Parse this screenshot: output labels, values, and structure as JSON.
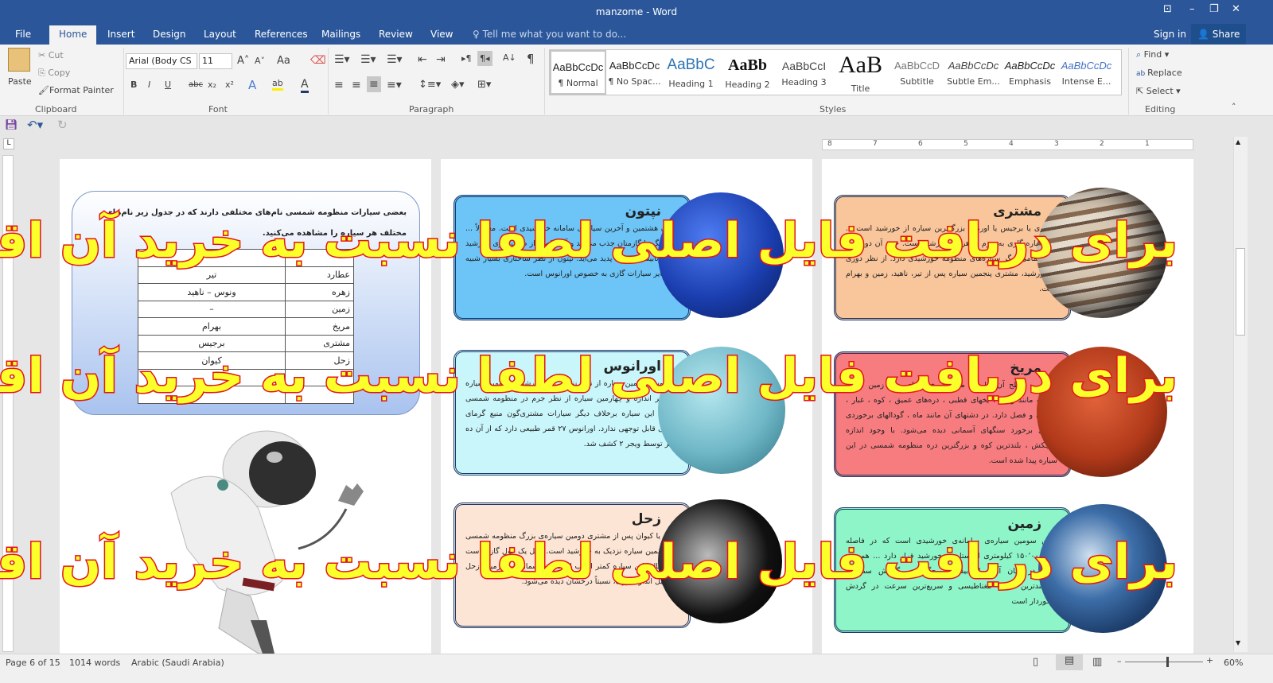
{
  "window": {
    "title": "manzome - Word",
    "controls": [
      "ribbon-display",
      "minimize",
      "restore",
      "close"
    ]
  },
  "tabs": [
    "File",
    "Home",
    "Insert",
    "Design",
    "Layout",
    "References",
    "Mailings",
    "Review",
    "View"
  ],
  "tell_me": "Tell me what you want to do...",
  "sign_in": "Sign in",
  "share": "Share",
  "clipboard": {
    "paste": "Paste",
    "cut": "Cut",
    "copy": "Copy",
    "format_painter": "Format Painter",
    "label": "Clipboard"
  },
  "font": {
    "name": "Arial (Body CS",
    "size": "11",
    "label": "Font",
    "bold": "B",
    "italic": "I",
    "underline": "U",
    "strike": "abc",
    "sub": "x₂",
    "sup": "x²",
    "case": "Aa"
  },
  "paragraph": {
    "label": "Paragraph"
  },
  "styles": {
    "label": "Styles",
    "items": [
      {
        "preview": "AaBbCcDc",
        "name": "¶ Normal"
      },
      {
        "preview": "AaBbCcDc",
        "name": "¶ No Spac..."
      },
      {
        "preview": "AaBbC",
        "name": "Heading 1"
      },
      {
        "preview": "AaBb",
        "name": "Heading 2"
      },
      {
        "preview": "AaBbCcI",
        "name": "Heading 3"
      },
      {
        "preview": "AaB",
        "name": "Title"
      },
      {
        "preview": "AaBbCcD",
        "name": "Subtitle"
      },
      {
        "preview": "AaBbCcDc",
        "name": "Subtle Em..."
      },
      {
        "preview": "AaBbCcDc",
        "name": "Emphasis"
      },
      {
        "preview": "AaBbCcDc",
        "name": "Intense E..."
      }
    ]
  },
  "editing": {
    "find": "Find",
    "replace": "Replace",
    "select": "Select",
    "label": "Editing"
  },
  "ruler": {
    "numbers": [
      "8",
      "7",
      "6",
      "5",
      "4",
      "3",
      "2",
      "1"
    ]
  },
  "page1": {
    "intro": "بعضی سیارات منظومه شمسی نام‌های مختلفی دارند که در جدول زیر نام‌های مختلف هر سیاره را مشاهده می‌کنید.",
    "table": [
      [
        "",
        ""
      ],
      [
        "عطارد",
        "تیر"
      ],
      [
        "زهره",
        "ونوس – ناهید"
      ],
      [
        "زمین",
        "–"
      ],
      [
        "مریخ",
        "بهرام"
      ],
      [
        "مشتری",
        "برجیس"
      ],
      [
        "زحل",
        "کیوان"
      ],
      [
        "",
        ""
      ],
      [
        "",
        ""
      ]
    ]
  },
  "cards": [
    {
      "title": "نپتون",
      "bg": "#6cc4f7",
      "text": "نپتون هشتمین و آخرین سیاره‌ی سامانه خورشیدی است. معمولاً ... این رنگ را گازمتان جذب می‌کند و آبی‌حاصل از طیف نوری خورشید که بازتابیده می‌شود پدید می‌آید. نپتون از نظر ساختاری بسیار شبیه به سایر سیارات گازی به خصوص اورانوس است."
    },
    {
      "title": "اورانوس",
      "bg": "#c9f6fb",
      "text": "اورانوس هفتمین سیاره از نظر نزدیکی به خورشید و سومین سیاره از نظر اندازه و چهارمین سیاره از نظر جرم در منظومه شمسی است. این سیاره برخلاف دیگر سیارات مشتری‌گون منبع گرمای داخلی قابل توجهی ندارد. اورانوس ۲۷ قمر طبیعی دارد که از آن ده قمر توسط ویجر ۲ کشف شد."
    },
    {
      "title": "زحل",
      "bg": "#fde5d5",
      "text": "زُحَل یا کیوان پس از مشتری دومین سیاره‌ی بزرگ منظومه شمسی و ششمین سیاره نزدیک به خورشید است. زحل یک غول گازی است ... چگالی این سیاره کمتر از آب است. در آسمان شب زمین، زحل به دلیل اندازه بزرگ، نسبتاً درخشان دیده می‌شود."
    },
    {
      "title": "مشتری",
      "bg": "#f9c59b",
      "text": "مُشتَری یا برجیس یا اورمزد بزرگ‌ترین سیاره از خورشید است ... این سیاره گازی به جرم یک‌هزارم خورشید است. جرم آن دو و نیم برابر تمامی دیگر سیاره‌های منظومهٔ خورشیدی دارد. از نظر دوری از خورشید، مشتری پنجمین سیاره پس از تیر، ناهید، زمین و بهرام است."
    },
    {
      "title": "مریخ",
      "bg": "#f77c7f",
      "text": "مریخ ... سطح آن برابر با مساحت خشکیهای روی زمین است. درست مانند زمین ، یخهای قطبی ، دره‌های عمیق ، کوه ، غبار ، طوفان و فصل دارد. در دشتهای آن مانند ماه ، گودالهای برخوردی حاصل برخورد سنگهای آسمانی دیده می‌شود. با وجود اندازه کوچکش ، بلندترین کوه و بزرگترین دره منظومه شمسی در این سیاره پیدا شده است."
    },
    {
      "title": "زمین",
      "bg": "#8ef5c9",
      "text": "زمین سومین سیاره‌ی سامانه‌ی خورشیدی است که در فاصله ۱۵۰٬۰۰۰٬۰۰۰ کیلومتری از ستاره‌ی خورشید قرار دارد ... همچنین زمین در میان آن‌ها از بیشترین چگالی و گرانش سطحی، نیرومندترین میدان مغناطیسی و سریع‌ترین سرعت در گردش برخوردار است"
    }
  ],
  "watermark": "برای دریافت فایل اصلی لطفا نسبت به خرید آن اقدام کنید",
  "status": {
    "page": "Page 6 of 15",
    "words": "1014 words",
    "language": "Arabic (Saudi Arabia)",
    "zoom": "60%",
    "zoom_level_percent": 60
  }
}
